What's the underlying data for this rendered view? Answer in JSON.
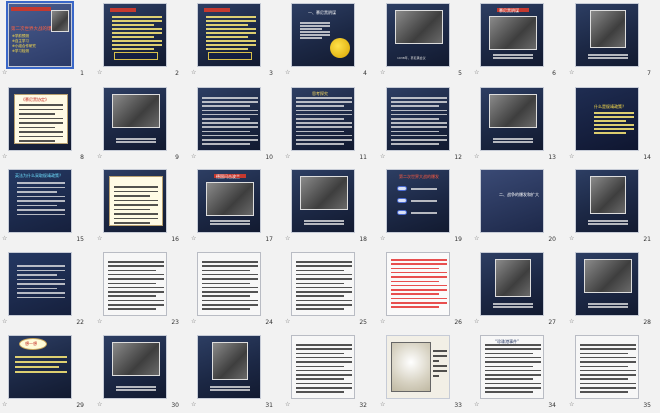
{
  "view": "slide-sorter",
  "rows": [
    {
      "slides": [
        {
          "number": "1",
          "theme": "title",
          "title": "第二次世界大战的爆发",
          "subtitle": "※学前预测",
          "lines": [
            "※学前预测",
            "※自主学习",
            "※小组合作研究",
            "※学习检测"
          ]
        },
        {
          "number": "2",
          "theme": "text-yellow"
        },
        {
          "number": "3",
          "theme": "text-yellow"
        },
        {
          "number": "4",
          "theme": "moon",
          "title": "一、慕尼黑阴谋"
        },
        {
          "number": "5",
          "theme": "photo",
          "caption": "1938年，慕尼黑会议"
        },
        {
          "number": "6",
          "theme": "photo-title",
          "title": "慕尼黑阴谋"
        },
        {
          "number": "7",
          "theme": "photo"
        }
      ]
    },
    {
      "slides": [
        {
          "number": "8",
          "theme": "paper",
          "title": "《慕尼黑协定》"
        },
        {
          "number": "9",
          "theme": "photo"
        },
        {
          "number": "10",
          "theme": "text"
        },
        {
          "number": "11",
          "theme": "text",
          "title": "思考探究"
        },
        {
          "number": "12",
          "theme": "text-white"
        },
        {
          "number": "13",
          "theme": "photo"
        },
        {
          "number": "14",
          "theme": "questions",
          "title": "什么是绥靖政策？"
        }
      ]
    },
    {
      "slides": [
        {
          "number": "15",
          "theme": "cyan",
          "title": "英法为什么采取绥靖政策？"
        },
        {
          "number": "16",
          "theme": "paper"
        },
        {
          "number": "17",
          "theme": "photo-title",
          "title": "德国闪击波兰"
        },
        {
          "number": "18",
          "theme": "photo"
        },
        {
          "number": "19",
          "theme": "buttons",
          "title": "第二次世界大战的爆发"
        },
        {
          "number": "20",
          "theme": "dark-title",
          "title": "二、战争的爆发和扩大"
        },
        {
          "number": "21",
          "theme": "photo"
        }
      ]
    },
    {
      "slides": [
        {
          "number": "22",
          "theme": "cyan"
        },
        {
          "number": "23",
          "theme": "white-text"
        },
        {
          "number": "24",
          "theme": "white-text"
        },
        {
          "number": "25",
          "theme": "white-text"
        },
        {
          "number": "26",
          "theme": "red-text"
        },
        {
          "number": "27",
          "theme": "photo"
        },
        {
          "number": "28",
          "theme": "photo"
        }
      ]
    },
    {
      "slides": [
        {
          "number": "29",
          "theme": "cloud",
          "title": "想一想"
        },
        {
          "number": "30",
          "theme": "photo"
        },
        {
          "number": "31",
          "theme": "photo"
        },
        {
          "number": "32",
          "theme": "white-text"
        },
        {
          "number": "33",
          "theme": "map"
        },
        {
          "number": "34",
          "theme": "white-text",
          "title": "“珍珠港事件”"
        },
        {
          "number": "35",
          "theme": "white-text"
        }
      ]
    }
  ],
  "transition_marker": "☆"
}
